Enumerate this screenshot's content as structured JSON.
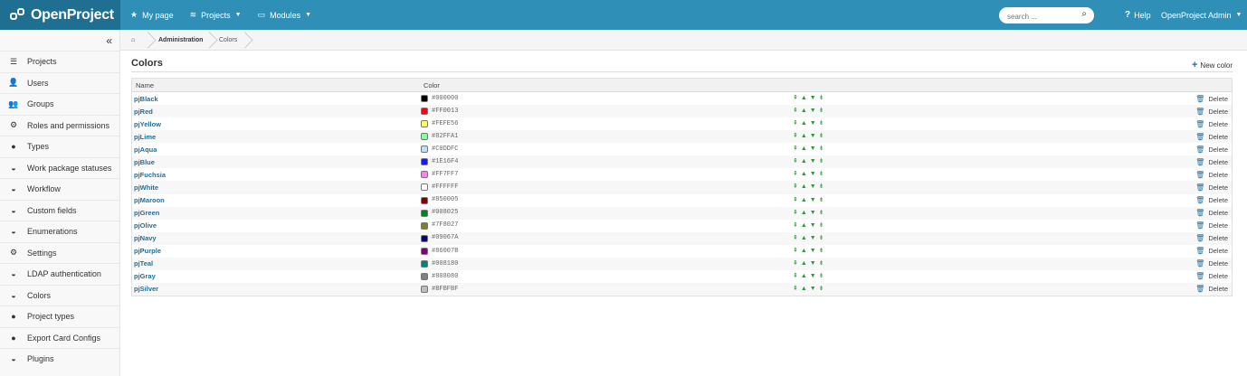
{
  "header": {
    "logo_text": "OpenProject",
    "nav": [
      {
        "label": "My page",
        "icon": "star-icon"
      },
      {
        "label": "Projects",
        "icon": "projects-icon"
      },
      {
        "label": "Modules",
        "icon": "modules-icon"
      }
    ],
    "search_placeholder": "search ...",
    "help_label": "Help",
    "user_label": "OpenProject Admin"
  },
  "sidebar": {
    "items": [
      {
        "label": "Projects",
        "icon": "list-icon"
      },
      {
        "label": "Users",
        "icon": "user-icon"
      },
      {
        "label": "Groups",
        "icon": "group-icon"
      },
      {
        "label": "Roles and permissions",
        "icon": "gear-icon"
      },
      {
        "label": "Types",
        "icon": "tag-icon"
      },
      {
        "label": "Work package statuses",
        "icon": "gauge-icon"
      },
      {
        "label": "Workflow",
        "icon": "gauge-icon"
      },
      {
        "label": "Custom fields",
        "icon": "gauge-icon"
      },
      {
        "label": "Enumerations",
        "icon": "gauge-icon"
      },
      {
        "label": "Settings",
        "icon": "gears-icon"
      },
      {
        "label": "LDAP authentication",
        "icon": "gauge-icon"
      },
      {
        "label": "Colors",
        "icon": "gauge-icon"
      },
      {
        "label": "Project types",
        "icon": "tag-icon"
      },
      {
        "label": "Export Card Configs",
        "icon": "tag-icon"
      },
      {
        "label": "Plugins",
        "icon": "gauge-icon"
      }
    ]
  },
  "breadcrumb": {
    "items": [
      "Administration",
      "Colors"
    ]
  },
  "main": {
    "title": "Colors",
    "new_color_label": "New color",
    "columns": [
      "Name",
      "Color"
    ],
    "delete_label": "Delete",
    "rows": [
      {
        "name": "pjBlack",
        "hex": "#000000"
      },
      {
        "name": "pjRed",
        "hex": "#FF0013"
      },
      {
        "name": "pjYellow",
        "hex": "#FEFE56"
      },
      {
        "name": "pjLime",
        "hex": "#82FFA1"
      },
      {
        "name": "pjAqua",
        "hex": "#C0DDFC"
      },
      {
        "name": "pjBlue",
        "hex": "#1E16F4"
      },
      {
        "name": "pjFuchsia",
        "hex": "#FF7FF7"
      },
      {
        "name": "pjWhite",
        "hex": "#FFFFFF"
      },
      {
        "name": "pjMaroon",
        "hex": "#850005"
      },
      {
        "name": "pjGreen",
        "hex": "#008025"
      },
      {
        "name": "pjOlive",
        "hex": "#7F8027"
      },
      {
        "name": "pjNavy",
        "hex": "#09067A"
      },
      {
        "name": "pjPurple",
        "hex": "#86007B"
      },
      {
        "name": "pjTeal",
        "hex": "#008180"
      },
      {
        "name": "pjGray",
        "hex": "#808080"
      },
      {
        "name": "pjSilver",
        "hex": "#BFBFBF"
      }
    ]
  },
  "colors": {
    "header_bg": "#2f8fb6",
    "logo_bg": "#1f6f92",
    "link": "#1b6fa0",
    "arrow_green": "#2a9a3a"
  }
}
